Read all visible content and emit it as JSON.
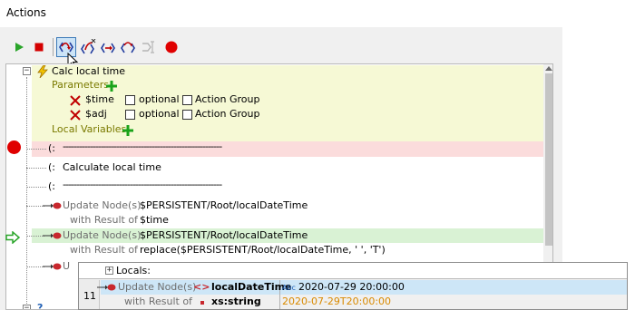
{
  "window": {
    "title": "Actions"
  },
  "toolbar": {
    "buttons": [
      {
        "name": "run",
        "icon": "play-icon"
      },
      {
        "name": "stop",
        "icon": "stop-icon"
      },
      {
        "name": "step-into",
        "icon": "step-into-icon",
        "active": true
      },
      {
        "name": "step-out",
        "icon": "step-out-icon"
      },
      {
        "name": "step-over",
        "icon": "step-over-icon"
      },
      {
        "name": "step-over-alt",
        "icon": "step-over-alt-icon"
      },
      {
        "name": "run-to-cursor",
        "icon": "run-to-cursor-icon",
        "disabled": true
      },
      {
        "name": "toggle-breakpoint",
        "icon": "breakpoint-icon"
      }
    ]
  },
  "tree": {
    "action_name": "Calc local time",
    "parameters_label": "Parameters",
    "params": [
      {
        "name": "$time",
        "optional_label": "optional",
        "group_label": "Action Group"
      },
      {
        "name": "$adj",
        "optional_label": "optional",
        "group_label": "Action Group"
      }
    ],
    "local_vars_label": "Local Variables",
    "comment_open": "(:",
    "comment_dashes": "-----------------------------------------------------------",
    "comment_text": "Calculate local time",
    "update1": {
      "label": "Update Node(s)",
      "target": "$PERSISTENT/Root/localDateTime",
      "with_label": "with Result of",
      "value": "$time"
    },
    "update2": {
      "label": "Update Node(s)",
      "target": "$PERSISTENT/Root/localDateTime",
      "with_label": "with Result of",
      "value": "replace($PERSISTENT/Root/localDateTime, ' ', 'T')"
    },
    "update3_partial": "U",
    "tail_partial": "?"
  },
  "locals": {
    "title": "Locals:",
    "line_number": "11",
    "row": {
      "label": "Update Node(s)",
      "name": "localDateTime",
      "type_badge": "Abc",
      "value": "2020-07-29 20:00:00",
      "with_label": "with Result of",
      "type": "xs:string",
      "result": "2020-07-29T20:00:00"
    }
  },
  "colors": {
    "breakpoint": "#e00000",
    "current_line": "#d9f2d4",
    "breakpoint_line": "#fbdcdc",
    "action_block": "#f6f9d5",
    "result_value": "#d98a00"
  }
}
